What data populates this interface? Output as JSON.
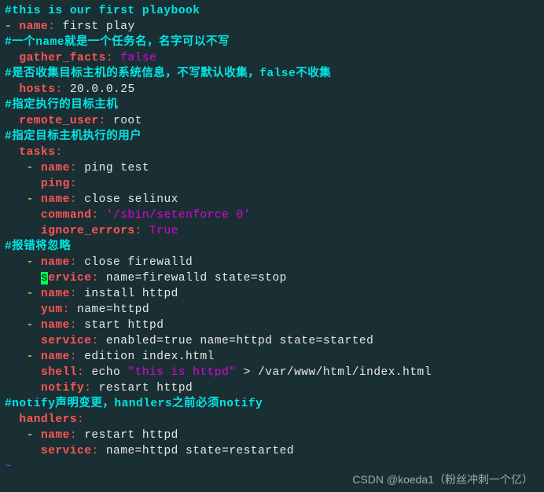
{
  "lines": {
    "c1": "#this is our first playbook",
    "l1_dash": "- ",
    "l1_key": "name",
    "l1_colon": ": ",
    "l1_val": "first play",
    "c2": "#一个name就是一个任务名，名字可以不写",
    "l3_indent": "  ",
    "l3_key": "gather_facts",
    "l3_colon": ": ",
    "l3_val": "false",
    "c3": "#是否收集目标主机的系统信息，不写默认收集，false不收集",
    "l5_indent": "  ",
    "l5_key": "hosts",
    "l5_colon": ": ",
    "l5_val": "20.0.0.25",
    "c4": "#指定执行的目标主机",
    "l7_indent": "  ",
    "l7_key": "remote_user",
    "l7_colon": ": ",
    "l7_val": "root",
    "c5": "#指定目标主机执行的用户",
    "l9_indent": "  ",
    "l9_key": "tasks",
    "l9_colon": ":",
    "l10_indent": "   ",
    "l10_dash": "- ",
    "l10_key": "name",
    "l10_colon": ": ",
    "l10_val": "ping test",
    "l11_indent": "     ",
    "l11_key": "ping",
    "l11_colon": ":",
    "l12_indent": "   ",
    "l12_dash": "- ",
    "l12_key": "name",
    "l12_colon": ": ",
    "l12_val": "close selinux",
    "l13_indent": "     ",
    "l13_key": "command",
    "l13_colon": ": ",
    "l13_val": "'/sbin/setenforce 0'",
    "l14_indent": "     ",
    "l14_key": "ignore_errors",
    "l14_colon": ": ",
    "l14_val": "True",
    "c6": "#报错将忽略",
    "l16_indent": "   ",
    "l16_dash": "- ",
    "l16_key": "name",
    "l16_colon": ": ",
    "l16_val": "close firewalld",
    "l17_indent": "     ",
    "l17_cursor": "s",
    "l17_key": "ervice",
    "l17_colon": ": ",
    "l17_val": "name=firewalld state=stop",
    "l18_indent": "   ",
    "l18_dash": "- ",
    "l18_key": "name",
    "l18_colon": ": ",
    "l18_val": "install httpd",
    "l19_indent": "     ",
    "l19_key": "yum",
    "l19_colon": ": ",
    "l19_val": "name=httpd",
    "l20_indent": "   ",
    "l20_dash": "- ",
    "l20_key": "name",
    "l20_colon": ": ",
    "l20_val": "start httpd",
    "l21_indent": "     ",
    "l21_key": "service",
    "l21_colon": ": ",
    "l21_val": "enabled=true name=httpd state=started",
    "l22_indent": "   ",
    "l22_dash": "- ",
    "l22_key": "name",
    "l22_colon": ": ",
    "l22_val": "edition index.html",
    "l23_indent": "     ",
    "l23_key": "shell",
    "l23_colon": ": ",
    "l23_val_a": "echo ",
    "l23_val_b": "\"this is httpd\"",
    "l23_val_c": " > ",
    "l23_val_d": "/var/www/html/index.html",
    "l24_indent": "     ",
    "l24_key": "notify",
    "l24_colon": ": ",
    "l24_val": "restart httpd",
    "c7": "#notify声明变更，handlers之前必须notify",
    "l26_indent": "  ",
    "l26_key": "handlers",
    "l26_colon": ":",
    "l27_indent": "   ",
    "l27_dash": "- ",
    "l27_key": "name",
    "l27_colon": ": ",
    "l27_val": "restart httpd",
    "l28_indent": "     ",
    "l28_key": "service",
    "l28_colon": ": ",
    "l28_val": "name=httpd state=restarted",
    "tilde": "~"
  },
  "watermark": "CSDN @koeda1（粉丝冲刺一个亿）"
}
